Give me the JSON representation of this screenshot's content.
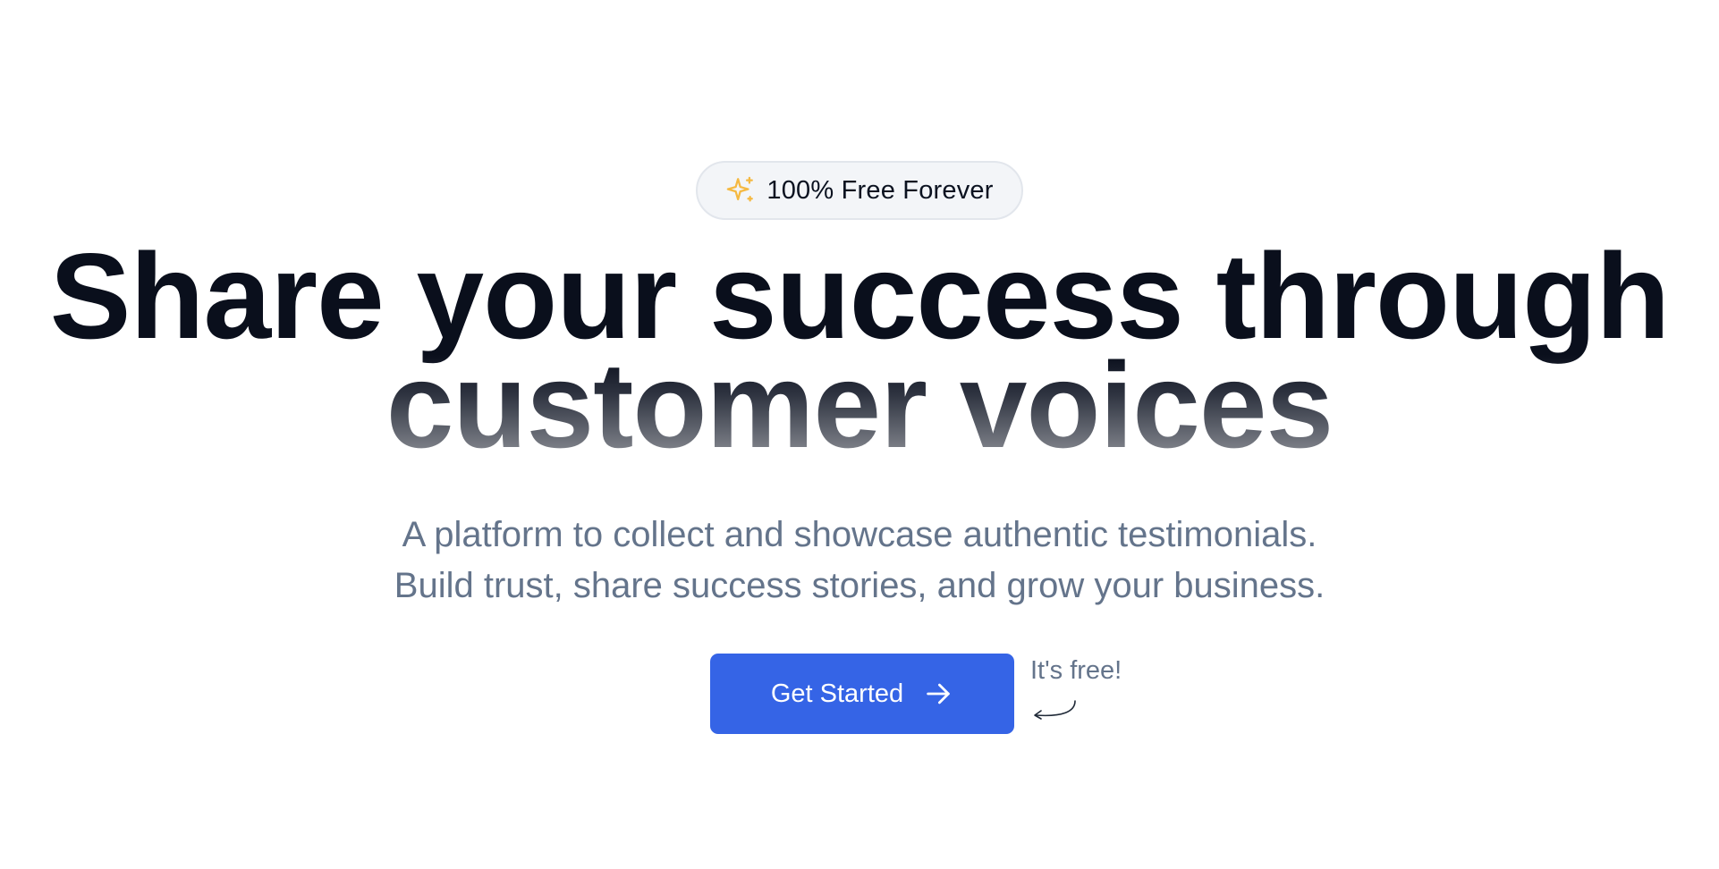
{
  "badge": {
    "icon": "sparkle-icon",
    "text": "100% Free Forever",
    "icon_color": "#f5b942"
  },
  "hero": {
    "headline_line1": "Share your success through",
    "headline_line2": "customer voices",
    "subtitle_line1": "A platform to collect and showcase authentic testimonials.",
    "subtitle_line2": "Build trust, share success stories, and grow your business."
  },
  "cta": {
    "label": "Get Started",
    "icon": "arrow-right-icon",
    "color": "#3564e6",
    "note": "It's free!",
    "note_icon": "curved-arrow-icon"
  }
}
